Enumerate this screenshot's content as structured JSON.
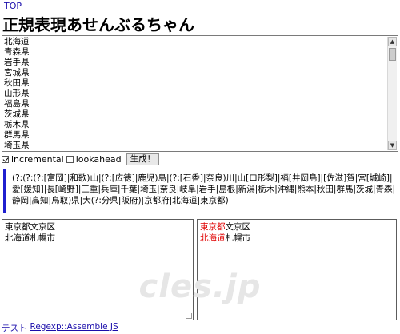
{
  "nav": {
    "top_link": "TOP"
  },
  "title": "正規表現あせんぶるちゃん",
  "words_input": {
    "items": [
      "北海道",
      "青森県",
      "岩手県",
      "宮城県",
      "秋田県",
      "山形県",
      "福島県",
      "茨城県",
      "栃木県",
      "群馬県",
      "埼玉県"
    ]
  },
  "controls": {
    "incremental_label": "incremental",
    "incremental_checked": true,
    "lookahead_label": "lookahead",
    "lookahead_checked": false,
    "generate_label": "生成！"
  },
  "regex_output": "(?:(?:(?:[富岡]|和歌)山|(?:[広徳]|鹿児)島|(?:[石香]|奈良)川|山[口形梨]|福[井岡島]|[佐滋]賀|宮[城崎]|愛[媛知]|長[崎野]|三重|兵庫|千葉|埼玉|奈良|岐阜|岩手|島根|新潟|栃木|沖縄|熊本|秋田|群馬|茨城|青森|静岡|高知|鳥取)県|大(?:分県|阪府)|京都府|北海道|東京都)",
  "test_input": {
    "line1": "東京都文京区",
    "line2": "北海道札幌市"
  },
  "test_result": {
    "line1_match": "東京都",
    "line1_rest": "文京区",
    "line2_match": "北海道",
    "line2_rest": "札幌市"
  },
  "watermark": "cles.jp",
  "footer": {
    "link1": "テスト",
    "link2": "Regexp::Assemble JS"
  },
  "colors": {
    "accent_bar": "#1f1fcf",
    "match_highlight": "#e00000",
    "link": "#1a0dab"
  }
}
